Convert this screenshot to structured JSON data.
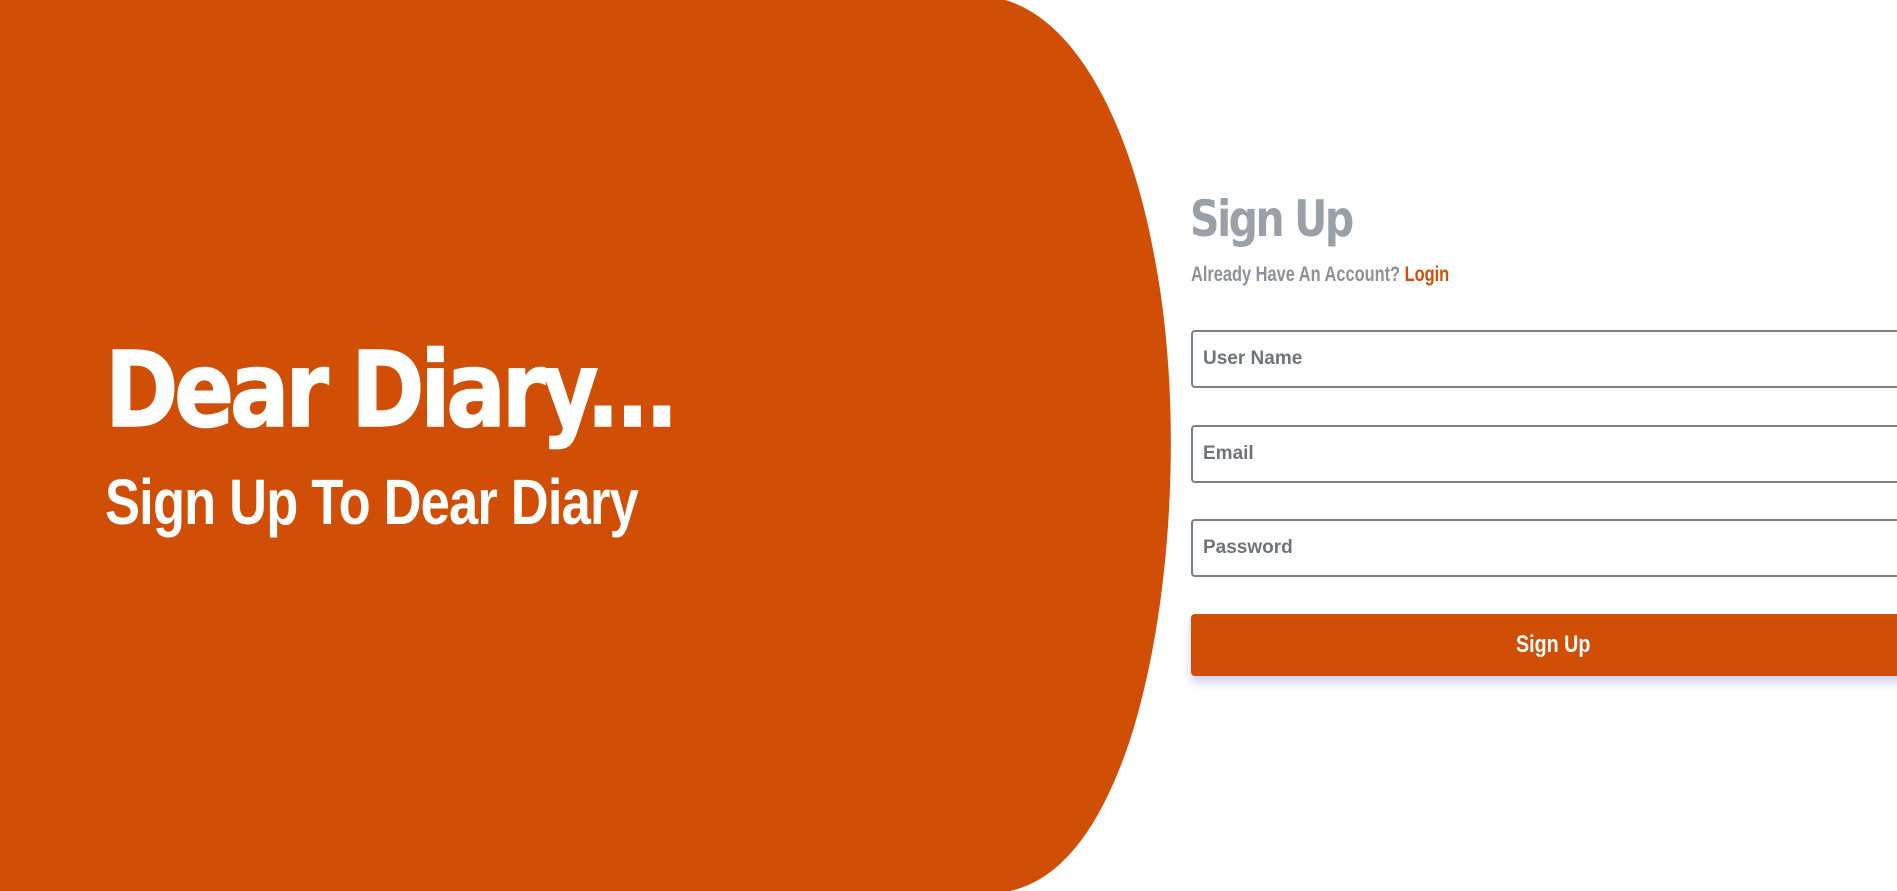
{
  "colors": {
    "accent": "#d04e05",
    "muted_text": "#9aa0a8",
    "background": "#ffffff"
  },
  "hero": {
    "title": "Dear Diary...",
    "subtitle": "Sign Up To Dear Diary"
  },
  "form": {
    "title": "Sign Up",
    "account_prompt": "Already Have An Account?",
    "login_link": "Login",
    "fields": [
      {
        "placeholder": "User Name",
        "value": ""
      },
      {
        "placeholder": "Email",
        "value": ""
      },
      {
        "placeholder": "Password",
        "value": ""
      }
    ],
    "submit_label": "Sign Up"
  }
}
